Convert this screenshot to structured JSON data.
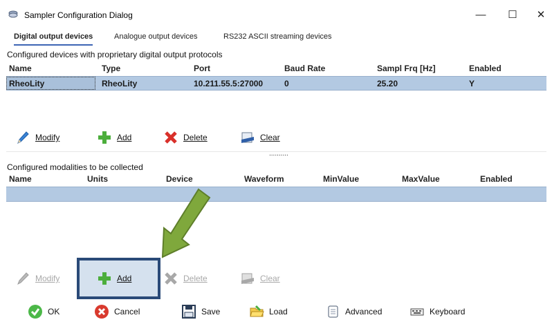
{
  "window": {
    "title": "Sampler Configuration Dialog",
    "minimize": "—",
    "maximize": "☐",
    "close": "✕"
  },
  "tabs": [
    {
      "label": "Digital output devices",
      "active": true
    },
    {
      "label": "Analogue output devices",
      "active": false
    },
    {
      "label": "RS232 ASCII streaming devices",
      "active": false
    }
  ],
  "devices": {
    "section_label": "Configured devices with proprietary digital output protocols",
    "columns": [
      "Name",
      "Type",
      "Port",
      "Baud Rate",
      "Sampl Frq [Hz]",
      "Enabled"
    ],
    "rows": [
      {
        "name": "RheoLity",
        "type": "RheoLity",
        "port": "10.211.55.5:27000",
        "baud": "0",
        "freq": "25.20",
        "enabled": "Y"
      }
    ]
  },
  "devices_toolbar": {
    "modify": "Modify",
    "add": "Add",
    "delete": "Delete",
    "clear": "Clear"
  },
  "splitter": "..........",
  "modalities": {
    "section_label": "Configured modalities to be collected",
    "columns": [
      "Name",
      "Units",
      "Device",
      "Waveform",
      "MinValue",
      "MaxValue",
      "Enabled"
    ]
  },
  "modalities_toolbar": {
    "modify": "Modify",
    "add": "Add",
    "delete": "Delete",
    "clear": "Clear"
  },
  "footer": {
    "ok": "OK",
    "cancel": "Cancel",
    "save": "Save",
    "load": "Load",
    "advanced": "Advanced",
    "keyboard": "Keyboard"
  },
  "colors": {
    "selection": "#b3c9e2",
    "arrow": "#7fa83c",
    "highlight_border": "#2a4a78"
  }
}
